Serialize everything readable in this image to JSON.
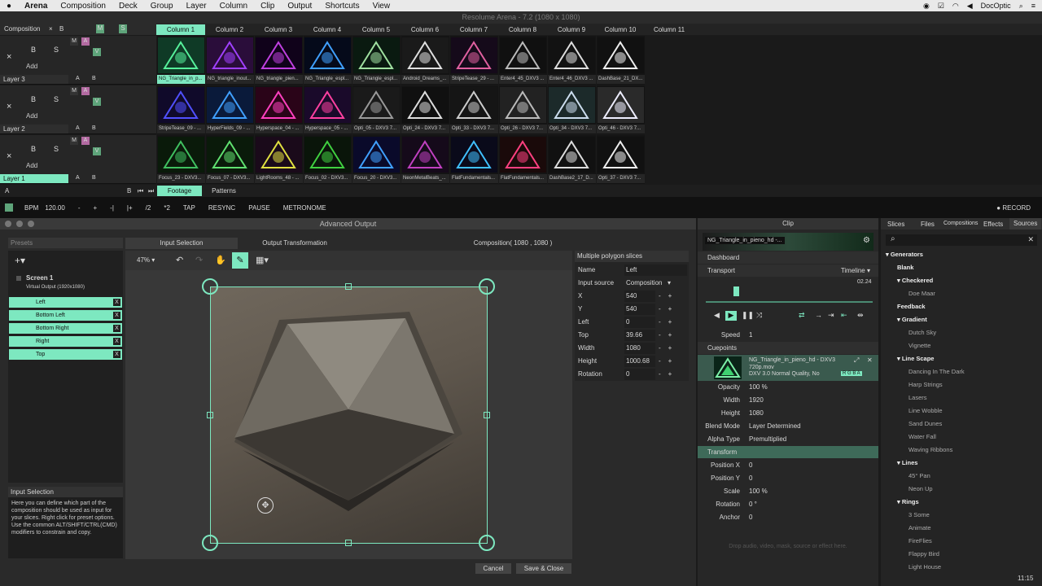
{
  "menubar": {
    "app": "Arena",
    "items": [
      "Composition",
      "Deck",
      "Group",
      "Layer",
      "Column",
      "Clip",
      "Output",
      "Shortcuts",
      "View"
    ],
    "right_app": "DocOptic"
  },
  "window_title": "Resolume Arena - 7.2 (1080 x 1080)",
  "composition": {
    "label": "Composition",
    "x": "×",
    "b": "B",
    "m": "M",
    "s": "S"
  },
  "columns": [
    "Column 1",
    "Column 2",
    "Column 3",
    "Column 4",
    "Column 5",
    "Column 6",
    "Column 7",
    "Column 8",
    "Column 9",
    "Column 10",
    "Column 11"
  ],
  "layers": [
    {
      "name": "Layer 3",
      "x": "×",
      "b": "B",
      "s": "S",
      "add": "Add",
      "m": "M",
      "a": "A",
      "v": "V",
      "ab_a": "A",
      "ab_b": "B",
      "clips": [
        "NG_Triangle_in_p...",
        "NG_triangle_inout...",
        "NG_triangle_pien...",
        "NG_Triangle_espl...",
        "NG_Triangle_espl...",
        "Android_Dreams_...",
        "StripeTease_29 - ...",
        "Enter4_45_DXV3 ...",
        "Enter4_46_DXV3 ...",
        "DashBase_21_DX..."
      ]
    },
    {
      "name": "Layer 2",
      "x": "×",
      "b": "B",
      "s": "S",
      "add": "Add",
      "m": "M",
      "a": "A",
      "v": "V",
      "ab_a": "A",
      "ab_b": "B",
      "clips": [
        "StripeTease_09 - ...",
        "HyperFields_09 - ...",
        "Hyperspace_04 - ...",
        "Hyperspace_05 - ...",
        "Opti_05 - DXV3 7...",
        "Opti_24 - DXV3 7...",
        "Opti_33 - DXV3 7...",
        "Opti_26 - DXV3 7...",
        "Opti_34 - DXV3 7...",
        "Opti_46 - DXV3 7..."
      ]
    },
    {
      "name": "Layer 1",
      "x": "×",
      "b": "B",
      "s": "S",
      "add": "Add",
      "m": "M",
      "a": "A",
      "v": "V",
      "ab_a": "A",
      "ab_b": "B",
      "clips": [
        "Focus_23 - DXV3...",
        "Focus_07 - DXV3...",
        "LightRooms_48 - ...",
        "Focus_02 - DXV3...",
        "Focus_20 - DXV3...",
        "NeonMetalBeats_...",
        "FlatFundamentals...",
        "FlatFundamentals...",
        "DashBase2_17_D...",
        "Opti_37 - DXV3 7..."
      ]
    }
  ],
  "deck": {
    "a": "A",
    "b": "B",
    "tabs": [
      "Footage",
      "Patterns"
    ]
  },
  "bpm": {
    "label": "BPM",
    "value": "120.00",
    "buttons": [
      "-",
      "+",
      "-|",
      "|+",
      "/2",
      "*2",
      "TAP",
      "RESYNC",
      "PAUSE",
      "METRONOME"
    ],
    "record": "RECORD"
  },
  "advanced": {
    "title": "Advanced Output",
    "presets": "Presets",
    "tabs": [
      "Input Selection",
      "Output Transformation"
    ],
    "comp_info": "Composition( 1080 , 1080 )",
    "screen": "Screen 1",
    "virtual": "Virtual Output (1920x1080)",
    "slices": [
      "Left",
      "Bottom Left",
      "Bottom Right",
      "Right",
      "Top"
    ],
    "zoom": "47%",
    "info_title": "Input Selection",
    "info_text": "Here you can define which part of the composition should be used as input for your slices. Right click for preset options. Use the common ALT/SHIFT/CTRL(CMD) modifiers to constrain and copy.",
    "props_title": "Multiple polygon slices",
    "props": [
      {
        "k": "Name",
        "v": "Left"
      },
      {
        "k": "Input source",
        "v": "Composition"
      },
      {
        "k": "X",
        "v": "540"
      },
      {
        "k": "Y",
        "v": "540"
      },
      {
        "k": "Left",
        "v": "0"
      },
      {
        "k": "Top",
        "v": "39.66"
      },
      {
        "k": "Width",
        "v": "1080"
      },
      {
        "k": "Height",
        "v": "1000.68"
      },
      {
        "k": "Rotation",
        "v": "0"
      }
    ],
    "cancel": "Cancel",
    "save": "Save & Close"
  },
  "clip": {
    "title": "Clip",
    "clip_name": "NG_Triangle_in_pieno_hd -...",
    "dashboard": "Dashboard",
    "transport": "Transport",
    "timeline": "Timeline",
    "time": "02.24",
    "speed_label": "Speed",
    "speed": "1",
    "cuepoints": "Cuepoints",
    "file": "NG_Triangle_in_pieno_hd - DXV3 720p.mov",
    "codec": "DXV 3.0 Normal Quality, No",
    "rgba": "R G B A",
    "rows": [
      {
        "k": "Opacity",
        "v": "100 %"
      },
      {
        "k": "Width",
        "v": "1920"
      },
      {
        "k": "Height",
        "v": "1080"
      },
      {
        "k": "Blend Mode",
        "v": "Layer Determined"
      },
      {
        "k": "Alpha Type",
        "v": "Premultiplied"
      }
    ],
    "transform": "Transform",
    "trows": [
      {
        "k": "Position X",
        "v": "0"
      },
      {
        "k": "Position Y",
        "v": "0"
      },
      {
        "k": "Scale",
        "v": "100 %"
      },
      {
        "k": "Rotation",
        "v": "0 °"
      },
      {
        "k": "Anchor",
        "v": "0"
      }
    ],
    "drop_hint": "Drop audio, video, mask, source or effect here."
  },
  "sources": {
    "tabs": [
      "Slices",
      "Files",
      "Compositions",
      "Effects",
      "Sources"
    ],
    "tree": [
      {
        "t": "Generators",
        "lvl": 0
      },
      {
        "t": "Blank",
        "lvl": 1
      },
      {
        "t": "Checkered",
        "lvl": 1
      },
      {
        "t": "Doe Maar",
        "lvl": 2
      },
      {
        "t": "Feedback",
        "lvl": 1
      },
      {
        "t": "Gradient",
        "lvl": 1
      },
      {
        "t": "Dutch Sky",
        "lvl": 2
      },
      {
        "t": "Vignette",
        "lvl": 2
      },
      {
        "t": "Line Scape",
        "lvl": 1
      },
      {
        "t": "Dancing In The Dark",
        "lvl": 2
      },
      {
        "t": "Harp Strings",
        "lvl": 2
      },
      {
        "t": "Lasers",
        "lvl": 2
      },
      {
        "t": "Line Wobble",
        "lvl": 2
      },
      {
        "t": "Sand Dunes",
        "lvl": 2
      },
      {
        "t": "Water Fall",
        "lvl": 2
      },
      {
        "t": "Waving Ribbons",
        "lvl": 2
      },
      {
        "t": "Lines",
        "lvl": 1
      },
      {
        "t": "45° Pan",
        "lvl": 2
      },
      {
        "t": "Neon Up",
        "lvl": 2
      },
      {
        "t": "Rings",
        "lvl": 1
      },
      {
        "t": "3 Some",
        "lvl": 2
      },
      {
        "t": "Animate",
        "lvl": 2
      },
      {
        "t": "FireFlies",
        "lvl": 2
      },
      {
        "t": "Flappy Bird",
        "lvl": 2
      },
      {
        "t": "Light House",
        "lvl": 2
      }
    ]
  },
  "clock": "11:15",
  "accent": "#7de8c0"
}
